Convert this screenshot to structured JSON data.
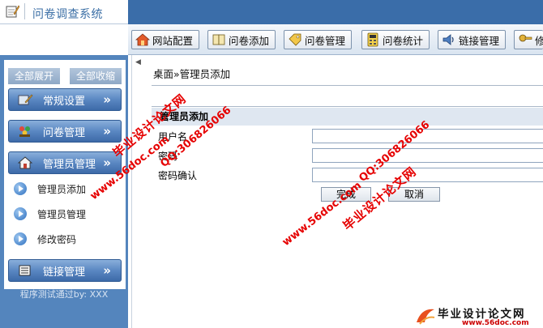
{
  "header": {
    "title": "问卷调查系统",
    "logo_icon": "notepad-pencil-icon",
    "bar_color": "#3a6da9"
  },
  "toolbar": {
    "buttons": [
      {
        "label": "网站配置",
        "icon": "home-icon"
      },
      {
        "label": "问卷添加",
        "icon": "book-icon"
      },
      {
        "label": "问卷管理",
        "icon": "tag-icon"
      },
      {
        "label": "问卷统计",
        "icon": "calculator-icon"
      },
      {
        "label": "链接管理",
        "icon": "speaker-icon"
      },
      {
        "label": "修",
        "icon": "key-icon"
      }
    ]
  },
  "sidebar": {
    "expand_all": "全部展开",
    "collapse_all": "全部收缩",
    "sections": [
      {
        "label": "常规设置",
        "icon": "settings-pencil-icon",
        "arrow": "»"
      },
      {
        "label": "问卷管理",
        "icon": "people-icon",
        "arrow": "»"
      },
      {
        "label": "管理员管理",
        "icon": "admin-house-icon",
        "arrow": "»"
      },
      {
        "label": "链接管理",
        "icon": "list-icon",
        "arrow": "»"
      }
    ],
    "sub_items": [
      "管理员添加",
      "管理员管理",
      "修改密码"
    ],
    "footer": "程序测试通过by: XXX"
  },
  "main": {
    "breadcrumb": "桌面»管理员添加",
    "form_title": "管理员添加",
    "fields": [
      {
        "label": "用户名",
        "value": ""
      },
      {
        "label": "密码",
        "value": ""
      },
      {
        "label": "密码确认",
        "value": ""
      }
    ],
    "submit_label": "完成",
    "cancel_label": "取消"
  },
  "watermarks": {
    "url": "www.56doc.com",
    "qq": "QQ:306826066",
    "name": "毕业设计论文网"
  },
  "brand": {
    "title": "毕业设计论文网",
    "url": "www.56doc.com"
  }
}
